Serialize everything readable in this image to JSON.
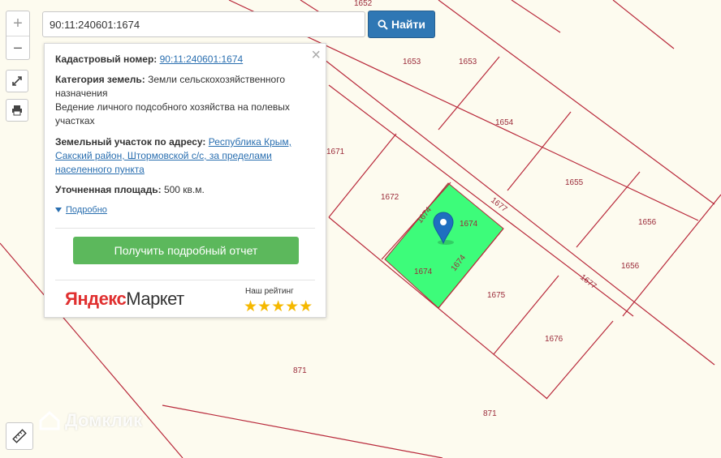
{
  "search": {
    "value": "90:11:240601:1674",
    "button_label": "Найти"
  },
  "zoom": {
    "in_label": "+",
    "out_label": "−"
  },
  "popup": {
    "cadastral_label": "Кадастровый номер:",
    "cadastral_value": "90:11:240601:1674",
    "category_label": "Категория земель:",
    "category_value": "Земли сельскохозяйственного назначения",
    "use_value": "Ведение личного подсобного хозяйства на полевых участках",
    "address_label": "Земельный участок по адресу:",
    "address_value": "Республика Крым, Сакский район, Штормовской с/с, за пределами населенного пункта",
    "area_label": "Уточненная площадь:",
    "area_value": "500 кв.м.",
    "details_label": "Подробно",
    "report_button": "Получить подробный отчет",
    "brand_part1": "Яндекс",
    "brand_part2": "Маркет",
    "rating_label": "Наш рейтинг",
    "stars": "★★★★★"
  },
  "watermark": "Домклик",
  "parcels": [
    {
      "label": "1652"
    },
    {
      "label": "1653"
    },
    {
      "label": "1653"
    },
    {
      "label": "1654"
    },
    {
      "label": "1671"
    },
    {
      "label": "1672"
    },
    {
      "label": "1677"
    },
    {
      "label": "1655"
    },
    {
      "label": "1674"
    },
    {
      "label": "1674"
    },
    {
      "label": "1674"
    },
    {
      "label": "1674"
    },
    {
      "label": "1656"
    },
    {
      "label": "1656"
    },
    {
      "label": "1677"
    },
    {
      "label": "1675"
    },
    {
      "label": "1676"
    },
    {
      "label": "871"
    },
    {
      "label": "871"
    }
  ],
  "colors": {
    "boundary": "#b8283a",
    "highlight": "#3dfc7a",
    "marker": "#1f6fc0",
    "background": "#fdfbef"
  }
}
